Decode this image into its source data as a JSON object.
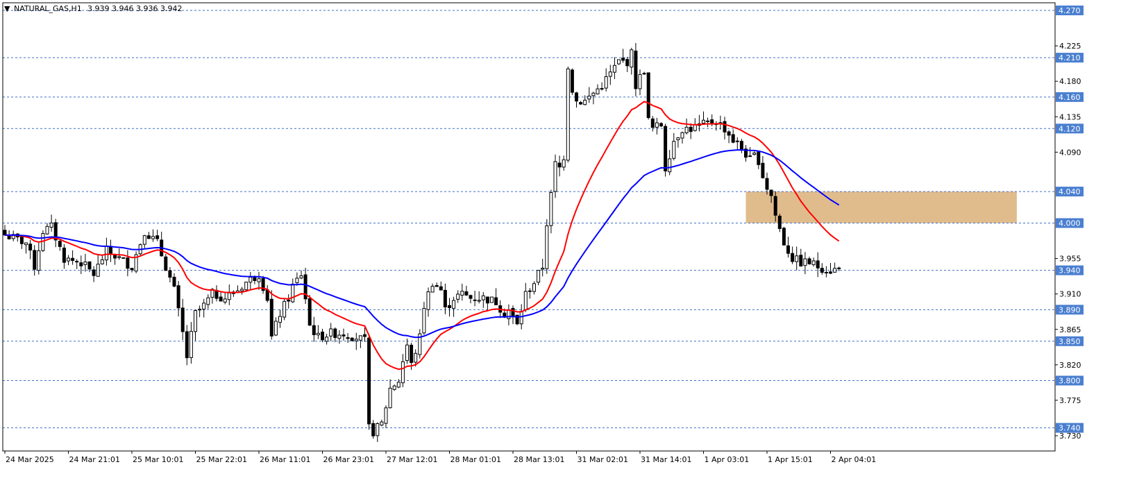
{
  "header": {
    "symbol": "NATURAL_GAS,H1",
    "ohlc": "3.939 3.946 3.936 3.942"
  },
  "colors": {
    "ma_fast": "#ff0000",
    "ma_slow": "#0000ff",
    "zone": "#deb887",
    "level_line": "#3c6ec8",
    "label_bg": "#4a7fd0",
    "candle": "#000000"
  },
  "chart_data": {
    "type": "candlestick",
    "symbol": "NATURAL_GAS",
    "timeframe": "H1",
    "ylim": [
      3.72,
      4.28
    ],
    "y_ticks": [
      4.27,
      4.225,
      4.18,
      4.135,
      4.09,
      4.045,
      4.0,
      3.955,
      3.91,
      3.865,
      3.82,
      3.775,
      3.73
    ],
    "levels": [
      4.27,
      4.21,
      4.16,
      4.12,
      4.04,
      4.0,
      3.94,
      3.89,
      3.85,
      3.8,
      3.74
    ],
    "level_labels": [
      "4.270",
      "4.210",
      "4.160",
      "4.120",
      "4.040",
      "4.000",
      "3.940",
      "3.890",
      "3.850",
      "3.800",
      "3.740"
    ],
    "y_tick_labels": [
      "4.225",
      "4.180",
      "4.135",
      "4.090",
      "3.955",
      "3.910",
      "3.865",
      "3.820",
      "3.775",
      "3.730"
    ],
    "zone": {
      "from_index": 175,
      "to_index": 239,
      "low": 4.0,
      "high": 4.04
    },
    "x_labels": [
      {
        "index": 0,
        "label": "24 Mar 2025"
      },
      {
        "index": 15,
        "label": "24 Mar 21:01"
      },
      {
        "index": 30,
        "label": "25 Mar 10:01"
      },
      {
        "index": 45,
        "label": "25 Mar 22:01"
      },
      {
        "index": 60,
        "label": "26 Mar 11:01"
      },
      {
        "index": 75,
        "label": "26 Mar 23:01"
      },
      {
        "index": 90,
        "label": "27 Mar 12:01"
      },
      {
        "index": 105,
        "label": "28 Mar 01:01"
      },
      {
        "index": 120,
        "label": "28 Mar 13:01"
      },
      {
        "index": 135,
        "label": "31 Mar 02:01"
      },
      {
        "index": 150,
        "label": "31 Mar 14:01"
      },
      {
        "index": 165,
        "label": "1 Apr 03:01"
      },
      {
        "index": 180,
        "label": "1 Apr 15:01"
      },
      {
        "index": 195,
        "label": "2 Apr 04:01"
      }
    ],
    "close_anchors": [
      [
        0,
        3.985
      ],
      [
        5,
        3.975
      ],
      [
        7,
        3.945
      ],
      [
        9,
        3.99
      ],
      [
        11,
        3.995
      ],
      [
        14,
        3.955
      ],
      [
        18,
        3.95
      ],
      [
        21,
        3.935
      ],
      [
        24,
        3.965
      ],
      [
        27,
        3.955
      ],
      [
        30,
        3.945
      ],
      [
        33,
        3.99
      ],
      [
        36,
        3.975
      ],
      [
        38,
        3.945
      ],
      [
        40,
        3.915
      ],
      [
        42,
        3.86
      ],
      [
        43,
        3.83
      ],
      [
        45,
        3.885
      ],
      [
        47,
        3.895
      ],
      [
        49,
        3.91
      ],
      [
        52,
        3.905
      ],
      [
        55,
        3.915
      ],
      [
        57,
        3.925
      ],
      [
        60,
        3.935
      ],
      [
        62,
        3.905
      ],
      [
        63,
        3.855
      ],
      [
        65,
        3.885
      ],
      [
        67,
        3.905
      ],
      [
        68,
        3.92
      ],
      [
        70,
        3.935
      ],
      [
        71,
        3.905
      ],
      [
        72,
        3.87
      ],
      [
        74,
        3.855
      ],
      [
        77,
        3.86
      ],
      [
        80,
        3.86
      ],
      [
        83,
        3.855
      ],
      [
        85,
        3.85
      ],
      [
        86,
        3.74
      ],
      [
        87,
        3.735
      ],
      [
        89,
        3.745
      ],
      [
        91,
        3.79
      ],
      [
        93,
        3.8
      ],
      [
        94,
        3.825
      ],
      [
        95,
        3.845
      ],
      [
        96,
        3.82
      ],
      [
        98,
        3.855
      ],
      [
        99,
        3.895
      ],
      [
        101,
        3.925
      ],
      [
        103,
        3.915
      ],
      [
        104,
        3.89
      ],
      [
        106,
        3.905
      ],
      [
        108,
        3.91
      ],
      [
        110,
        3.905
      ],
      [
        113,
        3.905
      ],
      [
        116,
        3.9
      ],
      [
        118,
        3.885
      ],
      [
        119,
        3.89
      ],
      [
        121,
        3.87
      ],
      [
        123,
        3.91
      ],
      [
        125,
        3.925
      ],
      [
        127,
        3.945
      ],
      [
        128,
        4.0
      ],
      [
        129,
        4.035
      ],
      [
        130,
        4.075
      ],
      [
        131,
        4.07
      ],
      [
        132,
        4.085
      ],
      [
        133,
        4.2
      ],
      [
        134,
        4.17
      ],
      [
        135,
        4.155
      ],
      [
        137,
        4.155
      ],
      [
        139,
        4.165
      ],
      [
        141,
        4.175
      ],
      [
        143,
        4.19
      ],
      [
        145,
        4.205
      ],
      [
        147,
        4.205
      ],
      [
        148,
        4.215
      ],
      [
        149,
        4.175
      ],
      [
        150,
        4.185
      ],
      [
        151,
        4.195
      ],
      [
        152,
        4.13
      ],
      [
        153,
        4.12
      ],
      [
        155,
        4.125
      ],
      [
        156,
        4.07
      ],
      [
        158,
        4.105
      ],
      [
        160,
        4.12
      ],
      [
        162,
        4.12
      ],
      [
        165,
        4.125
      ],
      [
        168,
        4.13
      ],
      [
        170,
        4.12
      ],
      [
        172,
        4.105
      ],
      [
        174,
        4.095
      ],
      [
        176,
        4.08
      ],
      [
        177,
        4.085
      ],
      [
        178,
        4.08
      ],
      [
        179,
        4.06
      ],
      [
        180,
        4.045
      ],
      [
        181,
        4.035
      ],
      [
        182,
        4.01
      ],
      [
        184,
        3.975
      ],
      [
        186,
        3.955
      ],
      [
        188,
        3.95
      ],
      [
        190,
        3.95
      ],
      [
        192,
        3.945
      ],
      [
        195,
        3.94
      ],
      [
        197,
        3.942
      ]
    ],
    "series": [
      {
        "name": "",
        "type": "line",
        "color": "#ff0000",
        "period": 20
      },
      {
        "name": "",
        "type": "line",
        "color": "#0000ff",
        "period": 50
      }
    ],
    "grid": false,
    "legend": "none"
  }
}
